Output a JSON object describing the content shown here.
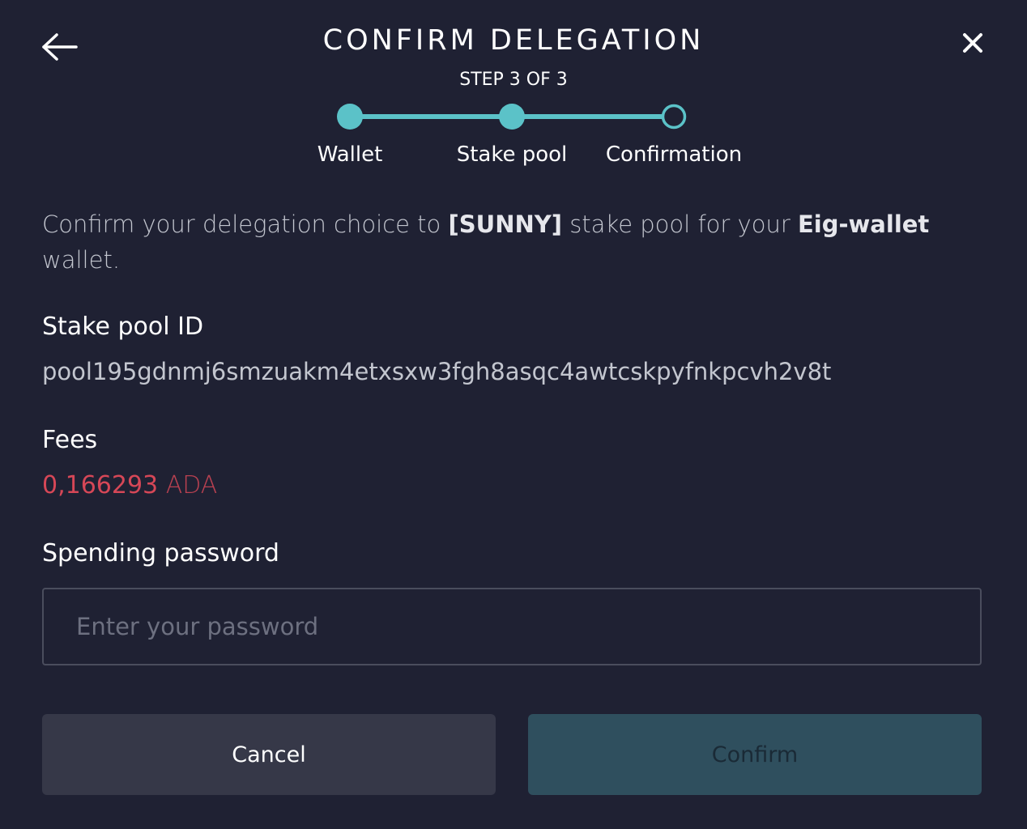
{
  "dialog": {
    "title": "CONFIRM DELEGATION",
    "step_label": "STEP 3 OF 3",
    "back_icon": "arrow-left-icon",
    "close_icon": "close-icon"
  },
  "stepper": {
    "steps": [
      {
        "label": "Wallet",
        "state": "completed"
      },
      {
        "label": "Stake pool",
        "state": "completed"
      },
      {
        "label": "Confirmation",
        "state": "current"
      }
    ],
    "accent_color": "#5bc2c8"
  },
  "description": {
    "prefix": "Confirm your delegation choice to ",
    "pool_ticker": "[SUNNY]",
    "middle": " stake pool for your ",
    "wallet_name": "Eig-wallet",
    "suffix": " wallet."
  },
  "stake_pool": {
    "label": "Stake pool ID",
    "id": "pool195gdnmj6smzuakm4etxsxw3fgh8asqc4awtcskpyfnkpcvh2v8t"
  },
  "fees": {
    "label": "Fees",
    "amount": "0,166293",
    "unit": " ADA",
    "color": "#ea4c5b"
  },
  "password": {
    "label": "Spending password",
    "value": "",
    "placeholder": "Enter your password"
  },
  "buttons": {
    "cancel_label": "Cancel",
    "confirm_label": "Confirm"
  }
}
